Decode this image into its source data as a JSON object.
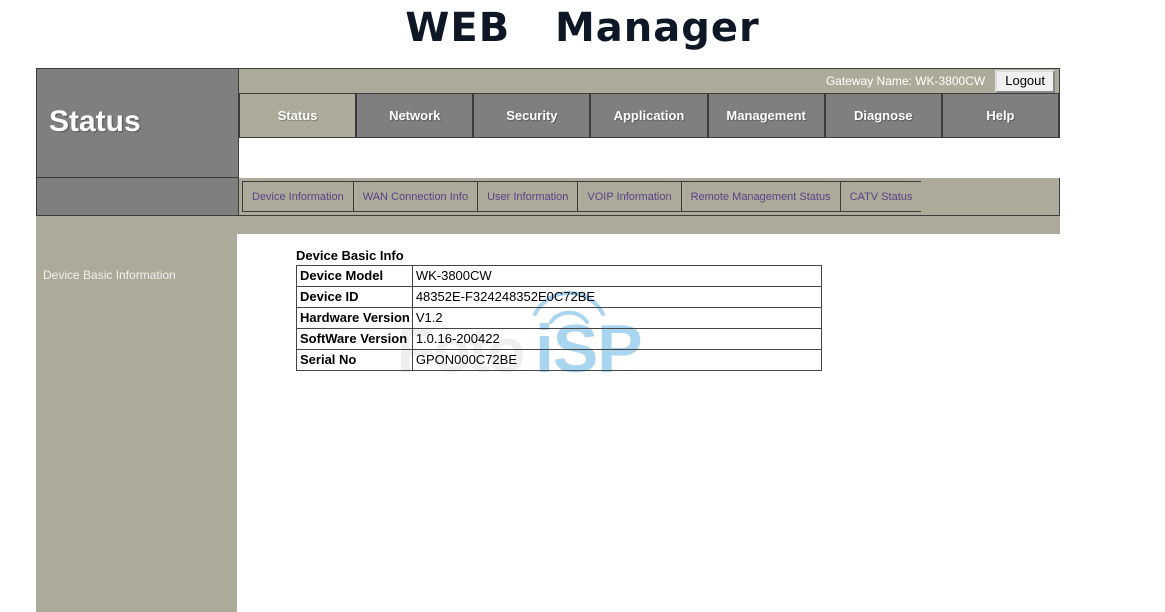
{
  "page": {
    "title": "WEB   Manager"
  },
  "header": {
    "gateway_label": "Gateway Name: WK-3800CW",
    "logout_label": "Logout"
  },
  "sidebar": {
    "banner_label": "Status",
    "items": [
      {
        "label": "Device Basic Information"
      }
    ]
  },
  "main_nav": {
    "items": [
      {
        "label": "Status",
        "active": true
      },
      {
        "label": "Network",
        "active": false
      },
      {
        "label": "Security",
        "active": false
      },
      {
        "label": "Application",
        "active": false
      },
      {
        "label": "Management",
        "active": false
      },
      {
        "label": "Diagnose",
        "active": false
      },
      {
        "label": "Help",
        "active": false
      }
    ]
  },
  "sub_nav": {
    "items": [
      {
        "label": "Device Information"
      },
      {
        "label": "WAN Connection Info"
      },
      {
        "label": "User Information"
      },
      {
        "label": "VOIP Information"
      },
      {
        "label": "Remote Management Status"
      },
      {
        "label": "CATV Status"
      }
    ]
  },
  "content": {
    "table_caption": "Device Basic Info",
    "rows": [
      {
        "label": "Device Model",
        "value": "WK-3800CW"
      },
      {
        "label": "Device ID",
        "value": "48352E-F324248352E0C72BE"
      },
      {
        "label": "Hardware Version",
        "value": "V1.2"
      },
      {
        "label": "SoftWare Version",
        "value": "1.0.16-200422"
      },
      {
        "label": "Serial No",
        "value": "GPON000C72BE"
      }
    ]
  },
  "watermark": {
    "text_left": "Foto",
    "text_right": "iSP"
  },
  "colors": {
    "khaki": "#acab99",
    "gray": "#7f7f7f",
    "border": "#3b3b3b",
    "subnav_link": "#5b3f8c",
    "watermark_blue": "#a8d5ef"
  }
}
